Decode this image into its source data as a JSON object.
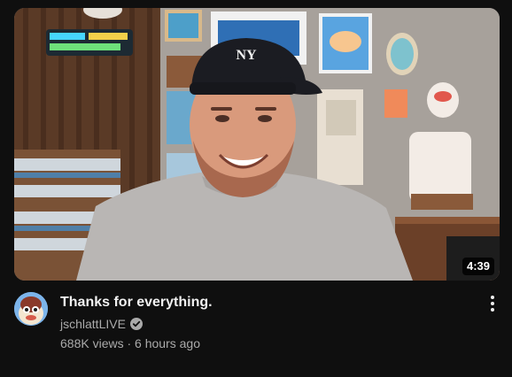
{
  "video": {
    "title": "Thanks for everything.",
    "duration": "4:39",
    "channel_name": "jschlattLIVE",
    "channel_verified_icon": "verified-check-icon",
    "views": "688K views",
    "separator": " · ",
    "age": "6 hours ago",
    "more_icon": "more-vert-icon"
  },
  "colors": {
    "background": "#0f0f0f",
    "title_text": "#f1f1f1",
    "secondary_text": "#aaaaaa",
    "duration_bg": "#000000"
  }
}
